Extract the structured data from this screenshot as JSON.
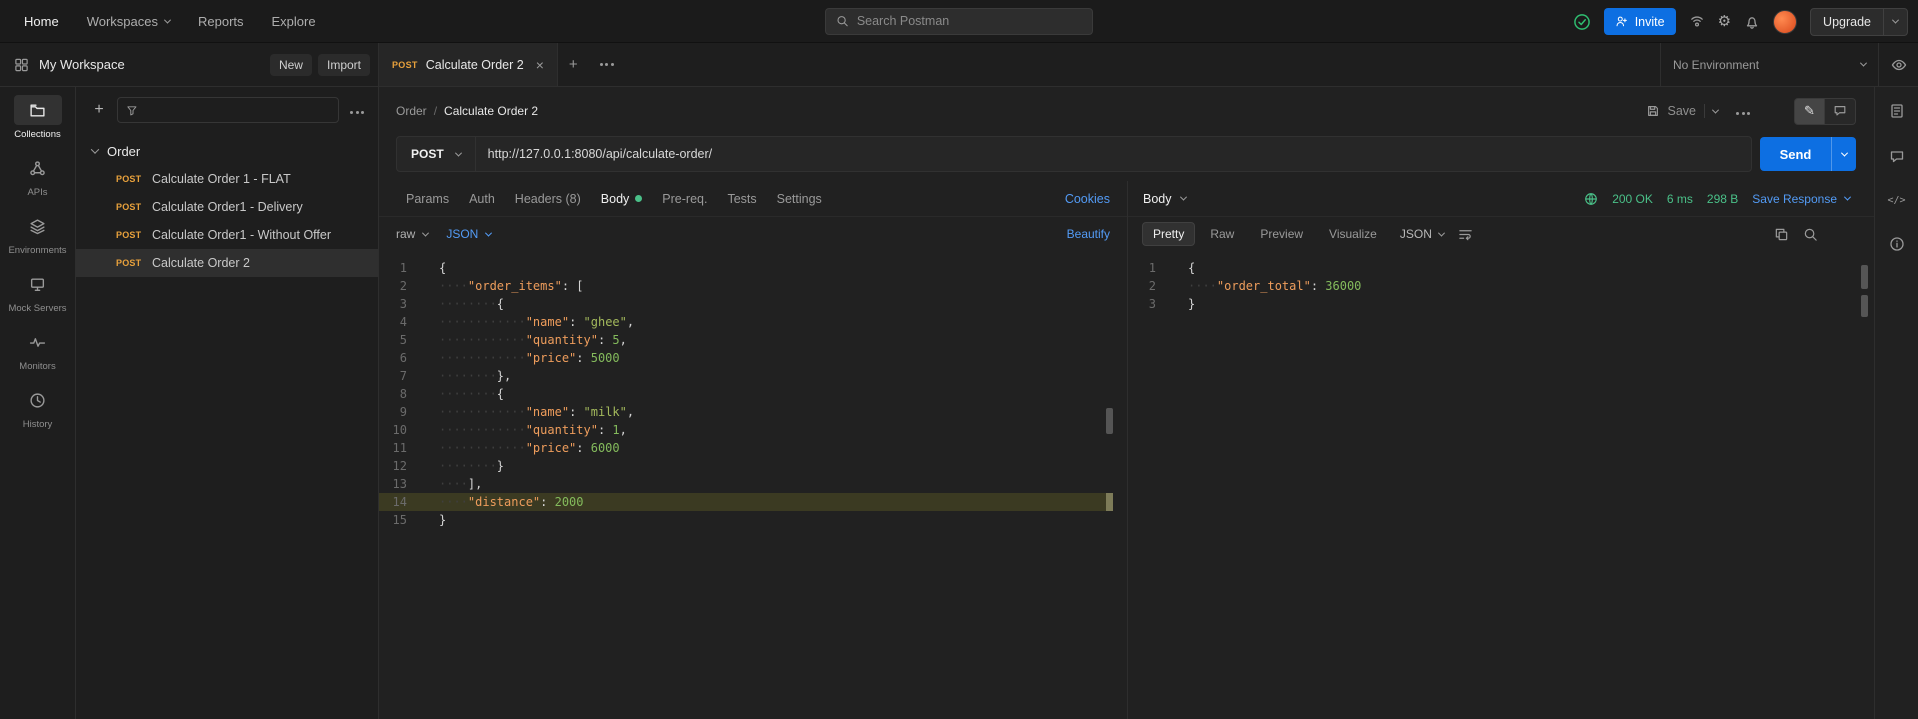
{
  "header": {
    "nav": [
      "Home",
      "Workspaces",
      "Reports",
      "Explore"
    ],
    "search_placeholder": "Search Postman",
    "invite_label": "Invite",
    "upgrade_label": "Upgrade"
  },
  "workspace_bar": {
    "workspace_name": "My Workspace",
    "new_label": "New",
    "import_label": "Import",
    "tab": {
      "method": "POST",
      "title": "Calculate Order 2"
    },
    "environment": "No Environment"
  },
  "left_rail": {
    "items": [
      {
        "label": "Collections"
      },
      {
        "label": "APIs"
      },
      {
        "label": "Environments"
      },
      {
        "label": "Mock Servers"
      },
      {
        "label": "Monitors"
      },
      {
        "label": "History"
      }
    ]
  },
  "sidebar": {
    "collection_name": "Order",
    "requests": [
      {
        "method": "POST",
        "name": "Calculate Order 1 - FLAT"
      },
      {
        "method": "POST",
        "name": "Calculate Order1 - Delivery"
      },
      {
        "method": "POST",
        "name": "Calculate Order1 - Without Offer"
      },
      {
        "method": "POST",
        "name": "Calculate Order 2"
      }
    ]
  },
  "request": {
    "breadcrumb": {
      "collection": "Order",
      "name": "Calculate Order 2"
    },
    "save_label": "Save",
    "method": "POST",
    "url": "http://127.0.0.1:8080/api/calculate-order/",
    "send_label": "Send",
    "tabs": [
      "Params",
      "Auth",
      "Headers (8)",
      "Body",
      "Pre-req.",
      "Tests",
      "Settings"
    ],
    "cookies_label": "Cookies",
    "body_type": "raw",
    "body_format": "JSON",
    "beautify_label": "Beautify"
  },
  "request_editor": {
    "lines": [
      {
        "num": 1,
        "tokens": [
          [
            "p",
            "{"
          ]
        ]
      },
      {
        "num": 2,
        "tokens": [
          [
            "ws",
            "····"
          ],
          [
            "k",
            "\"order_items\""
          ],
          [
            "p",
            ": ["
          ]
        ]
      },
      {
        "num": 3,
        "tokens": [
          [
            "ws",
            "········"
          ],
          [
            "p",
            "{"
          ]
        ]
      },
      {
        "num": 4,
        "tokens": [
          [
            "ws",
            "············"
          ],
          [
            "k",
            "\"name\""
          ],
          [
            "p",
            ": "
          ],
          [
            "s",
            "\"ghee\""
          ],
          [
            "p",
            ","
          ]
        ]
      },
      {
        "num": 5,
        "tokens": [
          [
            "ws",
            "············"
          ],
          [
            "k",
            "\"quantity\""
          ],
          [
            "p",
            ": "
          ],
          [
            "n",
            "5"
          ],
          [
            "p",
            ","
          ]
        ]
      },
      {
        "num": 6,
        "tokens": [
          [
            "ws",
            "············"
          ],
          [
            "k",
            "\"price\""
          ],
          [
            "p",
            ": "
          ],
          [
            "n",
            "5000"
          ]
        ]
      },
      {
        "num": 7,
        "tokens": [
          [
            "ws",
            "········"
          ],
          [
            "p",
            "},"
          ]
        ]
      },
      {
        "num": 8,
        "tokens": [
          [
            "ws",
            "········"
          ],
          [
            "p",
            "{"
          ]
        ]
      },
      {
        "num": 9,
        "tokens": [
          [
            "ws",
            "············"
          ],
          [
            "k",
            "\"name\""
          ],
          [
            "p",
            ": "
          ],
          [
            "s",
            "\"milk\""
          ],
          [
            "p",
            ","
          ]
        ]
      },
      {
        "num": 10,
        "tokens": [
          [
            "ws",
            "············"
          ],
          [
            "k",
            "\"quantity\""
          ],
          [
            "p",
            ": "
          ],
          [
            "n",
            "1"
          ],
          [
            "p",
            ","
          ]
        ]
      },
      {
        "num": 11,
        "tokens": [
          [
            "ws",
            "············"
          ],
          [
            "k",
            "\"price\""
          ],
          [
            "p",
            ": "
          ],
          [
            "n",
            "6000"
          ]
        ]
      },
      {
        "num": 12,
        "tokens": [
          [
            "ws",
            "········"
          ],
          [
            "p",
            "}"
          ]
        ]
      },
      {
        "num": 13,
        "tokens": [
          [
            "ws",
            "····"
          ],
          [
            "p",
            "],"
          ]
        ]
      },
      {
        "num": 14,
        "tokens": [
          [
            "ws",
            "····"
          ],
          [
            "k",
            "\"distance\""
          ],
          [
            "p",
            ": "
          ],
          [
            "n",
            "2000"
          ]
        ],
        "highlight": true
      },
      {
        "num": 15,
        "tokens": [
          [
            "p",
            "}"
          ]
        ]
      }
    ]
  },
  "response": {
    "body_label": "Body",
    "status": "200 OK",
    "time": "6 ms",
    "size": "298 B",
    "save_response_label": "Save Response",
    "tabs": [
      "Pretty",
      "Raw",
      "Preview",
      "Visualize"
    ],
    "format": "JSON"
  },
  "response_editor": {
    "lines": [
      {
        "num": 1,
        "tokens": [
          [
            "p",
            "{"
          ]
        ]
      },
      {
        "num": 2,
        "tokens": [
          [
            "ws",
            "····"
          ],
          [
            "k",
            "\"order_total\""
          ],
          [
            "p",
            ": "
          ],
          [
            "n",
            "36000"
          ]
        ]
      },
      {
        "num": 3,
        "tokens": [
          [
            "p",
            "}"
          ]
        ]
      }
    ]
  },
  "icons": {
    "plus": "+",
    "close": "×",
    "gear": "⚙",
    "pencil": "✎",
    "code_glyph": "</>"
  },
  "colors": {
    "method_post": "#e8a13c",
    "blue": "#0d6fe2",
    "link": "#539bf5",
    "success": "#4ac088",
    "brand": "#ff6c37",
    "json_key": "#ee9d5c",
    "json_string": "#a3b95c",
    "json_number": "#84bb5c",
    "hl_bg": "#3b3a22"
  }
}
